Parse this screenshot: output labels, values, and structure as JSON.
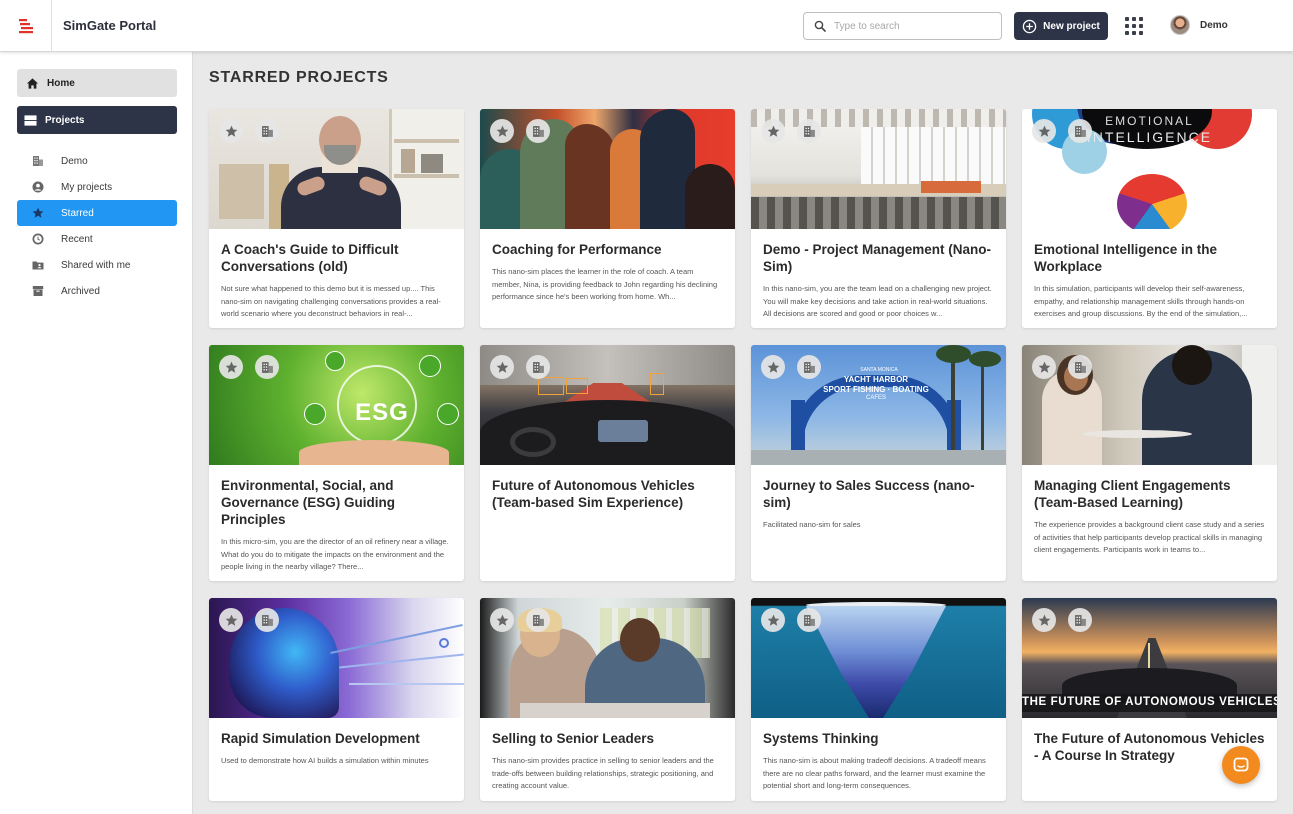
{
  "header": {
    "app_title": "SimGate Portal",
    "search_placeholder": "Type to search",
    "new_project_label": "New project",
    "user_name": "Demo"
  },
  "sidebar": {
    "home_label": "Home",
    "projects_label": "Projects",
    "items": [
      {
        "label": "Demo",
        "icon": "building-icon"
      },
      {
        "label": "My projects",
        "icon": "user-circle-icon"
      },
      {
        "label": "Starred",
        "icon": "star-icon",
        "active": true
      },
      {
        "label": "Recent",
        "icon": "clock-icon"
      },
      {
        "label": "Shared with me",
        "icon": "shared-folder-icon"
      },
      {
        "label": "Archived",
        "icon": "archive-icon"
      }
    ]
  },
  "main": {
    "section_title": "STARRED PROJECTS",
    "projects": [
      {
        "title": "A Coach's Guide to Difficult Conversations (old)",
        "description": "Not sure what happened to this demo but it is messed up.... This nano-sim on navigating challenging conversations provides a real-world scenario where you deconstruct behaviors in real-..."
      },
      {
        "title": "Coaching for Performance",
        "description": "This nano-sim places the learner in the role of coach. A team member, Nina, is providing feedback to John regarding his declining performance since he's been working from home. Wh..."
      },
      {
        "title": "Demo - Project Management (Nano-Sim)",
        "description": "In this nano-sim, you are the team lead on a challenging new project. You will make key decisions and take action in real-world situations. All decisions are scored and good or poor choices w..."
      },
      {
        "title": "Emotional Intelligence in the Workplace",
        "description": "In this simulation, participants will develop their self-awareness, empathy, and relationship management skills through hands-on exercises and group discussions. By the end of the simulation,..."
      },
      {
        "title": "Environmental, Social, and Governance (ESG) Guiding Principles",
        "description": "In this micro-sim, you are the director of an oil refinery near a village. What do you do to mitigate the impacts on the environment and the people living in the nearby village? There..."
      },
      {
        "title": "Future of Autonomous Vehicles (Team-based Sim Experience)",
        "description": ""
      },
      {
        "title": "Journey to Sales Success (nano-sim)",
        "description": "Facilitated nano-sim for sales"
      },
      {
        "title": "Managing Client Engagements (Team-Based Learning)",
        "description": "The experience provides a background client case study and a series of activities that help participants develop practical skills in managing client engagements. Participants work in teams to..."
      },
      {
        "title": "Rapid Simulation Development",
        "description": "Used to demonstrate how AI builds a simulation within minutes"
      },
      {
        "title": "Selling to Senior Leaders",
        "description": "This nano-sim provides practice in selling to senior leaders and the trade-offs between building relationships, strategic positioning, and creating account value."
      },
      {
        "title": "Systems Thinking",
        "description": "This nano-sim is about making tradeoff decisions. A tradeoff means there are no clear paths forward, and the learner must examine the potential short and long-term consequences."
      },
      {
        "title": "The Future of Autonomous Vehicles - A Course In Strategy",
        "description": ""
      }
    ]
  },
  "image_text": {
    "esg": "ESG",
    "emotional": "EMOTIONAL",
    "intelligence": "INTELLIGENCE",
    "future_banner": "THE FUTURE OF AUTONOMOUS VEHICLES",
    "sign_top": "SANTA MONICA",
    "sign_main": "YACHT HARBOR",
    "sign_sub": "SPORT FISHING · BOATING",
    "sign_cafe": "CAFES"
  },
  "colors": {
    "accent": "#2296f3",
    "dark": "#2e3447",
    "chat": "#f28a1e",
    "logo": "#e0322b"
  }
}
